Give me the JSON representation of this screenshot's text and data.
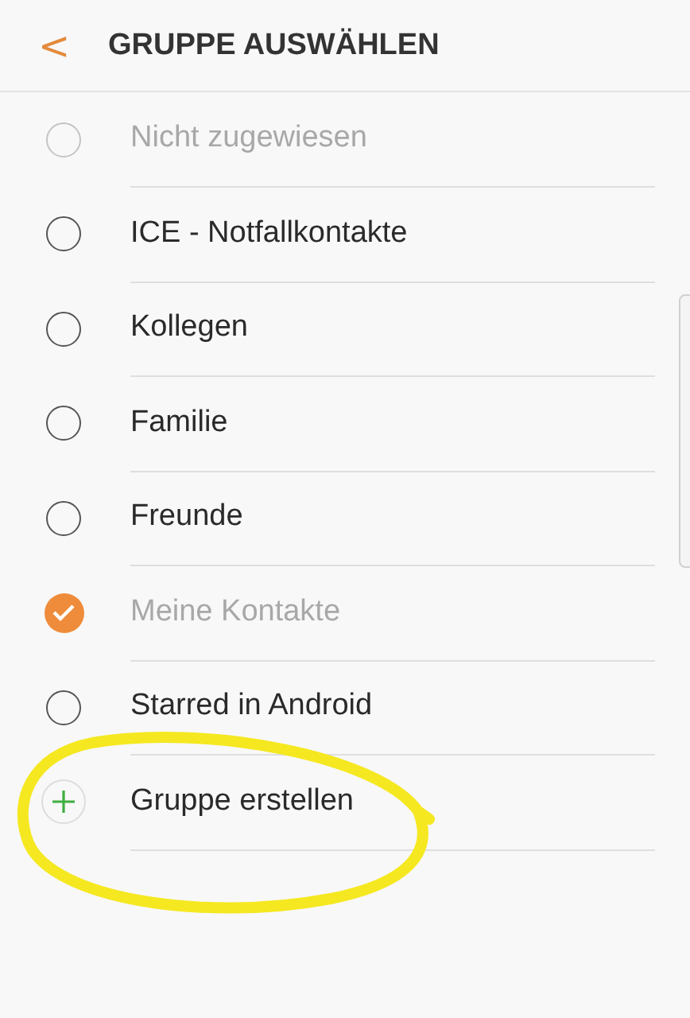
{
  "header": {
    "back": "<",
    "title": "GRUPPE AUSWÄHLEN"
  },
  "groups": [
    {
      "kind": "radio",
      "label": "Nicht zugewiesen",
      "selected": false,
      "disabled": true
    },
    {
      "kind": "radio",
      "label": "ICE - Notfallkontakte",
      "selected": false,
      "disabled": false
    },
    {
      "kind": "radio",
      "label": "Kollegen",
      "selected": false,
      "disabled": false
    },
    {
      "kind": "radio",
      "label": "Familie",
      "selected": false,
      "disabled": false
    },
    {
      "kind": "radio",
      "label": "Freunde",
      "selected": false,
      "disabled": false
    },
    {
      "kind": "radio",
      "label": "Meine Kontakte",
      "selected": true,
      "disabled": true
    },
    {
      "kind": "radio",
      "label": "Starred in Android",
      "selected": false,
      "disabled": false
    },
    {
      "kind": "add",
      "label": "Gruppe erstellen"
    }
  ]
}
